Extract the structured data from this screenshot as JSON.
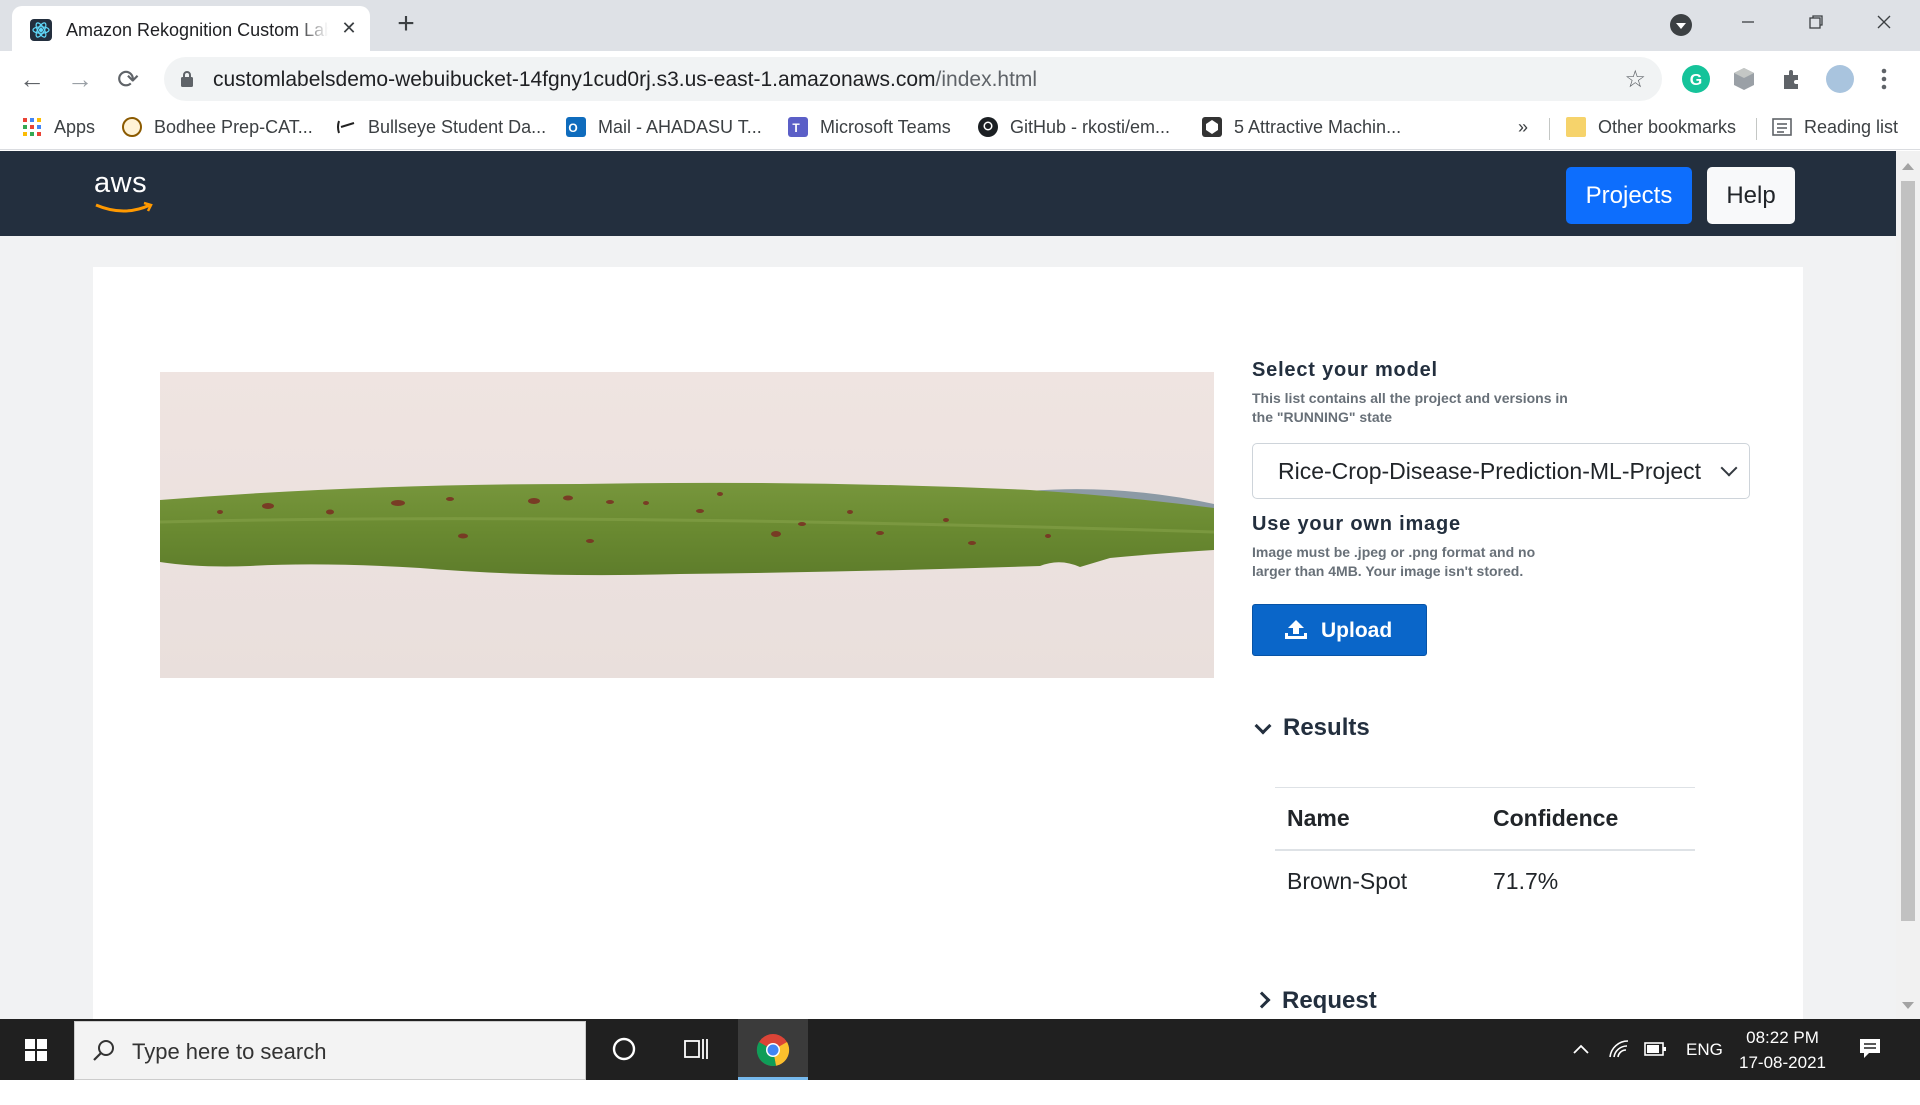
{
  "browser": {
    "tab_title": "Amazon Rekognition Custom Labels",
    "tab_close": "✕",
    "new_tab": "+",
    "url_host": "customlabelsdemo-webuibucket-14fgny1cud0rj.s3.us-east-1.amazonaws.com",
    "url_path": "/index.html",
    "bookmarks": [
      {
        "label": "Apps",
        "icon": "apps-grid-icon"
      },
      {
        "label": "Bodhee Prep-CAT...",
        "icon": "bodhee-icon"
      },
      {
        "label": "Bullseye Student Da...",
        "icon": "bullseye-icon"
      },
      {
        "label": "Mail - AHADASU T...",
        "icon": "outlook-icon"
      },
      {
        "label": "Microsoft Teams",
        "icon": "teams-icon"
      },
      {
        "label": "GitHub - rkosti/em...",
        "icon": "github-icon"
      },
      {
        "label": "5 Attractive Machin...",
        "icon": "site-icon"
      }
    ],
    "overflow_chevron": "»",
    "other_bookmarks": "Other bookmarks",
    "reading_list": "Reading list"
  },
  "app": {
    "logo": "aws",
    "nav_projects": "Projects",
    "nav_help": "Help",
    "select_model_heading": "Select your model",
    "select_model_sub": "This list contains all the project and versions in the \"RUNNING\" state",
    "selected_model": "Rice-Crop-Disease-Prediction-ML-Project",
    "own_image_heading": "Use your own image",
    "own_image_sub": "Image must be .jpeg or .png format and no larger than 4MB. Your image isn't stored.",
    "upload_label": "Upload",
    "results_heading": "Results",
    "table_headers": [
      "Name",
      "Confidence"
    ],
    "results_rows": [
      {
        "name": "Brown-Spot",
        "confidence": "71.7%"
      }
    ],
    "request_heading": "Request"
  },
  "taskbar": {
    "search_placeholder": "Type here to search",
    "language": "ENG",
    "time": "08:22 PM",
    "date": "17-08-2021"
  },
  "colors": {
    "aws_navy": "#232f3e",
    "aws_orange": "#ff9900",
    "primary_blue": "#0d6efd",
    "upload_blue": "#0a66c9"
  }
}
